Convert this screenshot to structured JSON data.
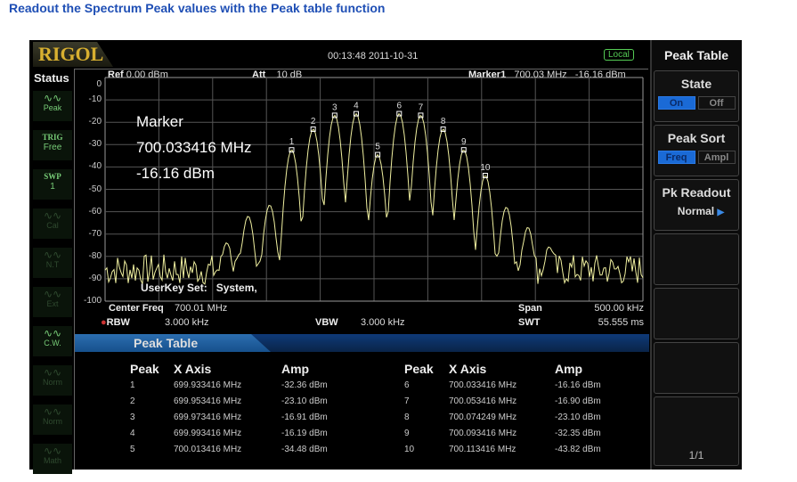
{
  "caption": "Readout the Spectrum Peak values with the Peak table function",
  "header": {
    "logo": "RIGOL",
    "datetime": "00:13:48 2011-10-31",
    "local": "Local"
  },
  "status": {
    "label": "Status",
    "items": [
      {
        "icon": "peak-wave-icon",
        "label": "Peak",
        "active": true
      },
      {
        "icon": "trig-text",
        "top": "TRIG",
        "label": "Free",
        "active": true
      },
      {
        "icon": "swp-text",
        "top": "SWP",
        "label": "1",
        "active": true
      },
      {
        "icon": "cal-icon",
        "label": "Cal",
        "active": false
      },
      {
        "icon": "nt-icon",
        "label": "N.T",
        "active": false
      },
      {
        "icon": "ext-icon",
        "label": "Ext",
        "active": false
      },
      {
        "icon": "cw-wave-icon",
        "label": "C.W.",
        "active": true
      },
      {
        "icon": "norm-wave-icon",
        "label": "Norm",
        "active": false
      },
      {
        "icon": "norm-wave-icon",
        "label": "Norm",
        "active": false
      },
      {
        "icon": "math-wave-icon",
        "label": "Math",
        "active": false
      }
    ]
  },
  "top_info": {
    "ref_label": "Ref",
    "ref_value": "0.00 dBm",
    "att_label": "Att",
    "att_value": "10 dB",
    "marker_label": "Marker1",
    "marker_freq": "700.03 MHz",
    "marker_amp": "-16.16 dBm"
  },
  "marker_box": {
    "title": "Marker",
    "freq": "700.033416 MHz",
    "amp": "-16.16 dBm"
  },
  "userkey": "UserKey Set:   System,",
  "y_ticks": [
    "0",
    "-10",
    "-20",
    "-30",
    "-40",
    "-50",
    "-60",
    "-70",
    "-80",
    "-90",
    "-100"
  ],
  "bottom_info": {
    "center_label": "Center Freq",
    "center_value": "700.01 MHz",
    "rbw_label": "RBW",
    "rbw_value": "3.000 kHz",
    "vbw_label": "VBW",
    "vbw_value": "3.000 kHz",
    "span_label": "Span",
    "span_value": "500.00 kHz",
    "swt_label": "SWT",
    "swt_value": "55.555 ms"
  },
  "trace": {
    "center_mhz": 700.01,
    "span_khz": 500,
    "ref_dbm": 0,
    "bottom_dbm": -100,
    "color": "#f0f0a0"
  },
  "peak_table": {
    "title": "Peak Table",
    "headers": [
      "Peak",
      "X Axis",
      "Amp"
    ],
    "rows": [
      {
        "n": "1",
        "x": "699.933416 MHz",
        "amp": "-32.36 dBm",
        "mhz": 699.933416,
        "dbm": -32.36
      },
      {
        "n": "2",
        "x": "699.953416 MHz",
        "amp": "-23.10 dBm",
        "mhz": 699.953416,
        "dbm": -23.1
      },
      {
        "n": "3",
        "x": "699.973416 MHz",
        "amp": "-16.91 dBm",
        "mhz": 699.973416,
        "dbm": -16.91
      },
      {
        "n": "4",
        "x": "699.993416 MHz",
        "amp": "-16.19 dBm",
        "mhz": 699.993416,
        "dbm": -16.19
      },
      {
        "n": "5",
        "x": "700.013416 MHz",
        "amp": "-34.48 dBm",
        "mhz": 700.013416,
        "dbm": -34.48
      },
      {
        "n": "6",
        "x": "700.033416 MHz",
        "amp": "-16.16 dBm",
        "mhz": 700.033416,
        "dbm": -16.16
      },
      {
        "n": "7",
        "x": "700.053416 MHz",
        "amp": "-16.90 dBm",
        "mhz": 700.053416,
        "dbm": -16.9
      },
      {
        "n": "8",
        "x": "700.074249 MHz",
        "amp": "-23.10 dBm",
        "mhz": 700.074249,
        "dbm": -23.1
      },
      {
        "n": "9",
        "x": "700.093416 MHz",
        "amp": "-32.35 dBm",
        "mhz": 700.093416,
        "dbm": -32.35
      },
      {
        "n": "10",
        "x": "700.113416 MHz",
        "amp": "-43.82 dBm",
        "mhz": 700.113416,
        "dbm": -43.82
      }
    ]
  },
  "softkeys": {
    "title": "Peak Table",
    "state": {
      "label": "State",
      "on": "On",
      "off": "Off"
    },
    "sort": {
      "label": "Peak Sort",
      "a": "Freq",
      "b": "Ampl"
    },
    "readout": {
      "label": "Pk Readout",
      "value": "Normal"
    },
    "page": "1/1"
  }
}
